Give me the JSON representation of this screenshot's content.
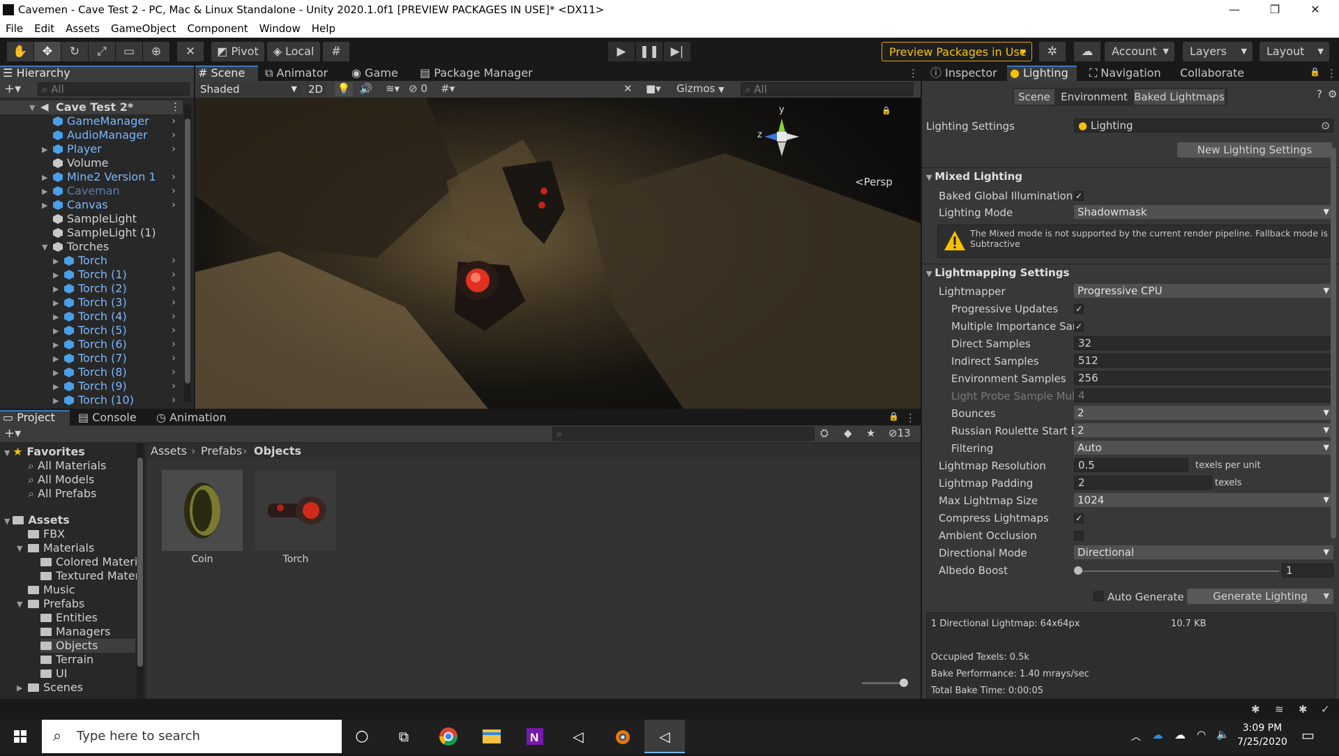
{
  "window": {
    "title": "Cavemen - Cave Test 2 - PC, Mac & Linux Standalone - Unity 2020.1.0f1 [PREVIEW PACKAGES IN USE]* <DX11>",
    "minimize": "—",
    "maximize": "❐",
    "close": "✕"
  },
  "menu": [
    "File",
    "Edit",
    "Assets",
    "GameObject",
    "Component",
    "Window",
    "Help"
  ],
  "toolbar": {
    "pivot": "Pivot",
    "local": "Local",
    "preview_packages": "Preview Packages in Use",
    "account": "Account",
    "layers": "Layers",
    "layout": "Layout"
  },
  "hierarchy": {
    "tab": "Hierarchy",
    "search_placeholder": "All",
    "scene": "Cave Test 2*",
    "items": [
      {
        "label": "GameManager",
        "type": "prefab"
      },
      {
        "label": "AudioManager",
        "type": "prefab"
      },
      {
        "label": "Player",
        "type": "prefab"
      },
      {
        "label": "Volume",
        "type": "object"
      },
      {
        "label": "Mine2 Version 1",
        "type": "prefab"
      },
      {
        "label": "Caveman",
        "type": "prefab-disabled"
      },
      {
        "label": "Canvas",
        "type": "prefab"
      },
      {
        "label": "SampleLight",
        "type": "object"
      },
      {
        "label": "SampleLight (1)",
        "type": "object"
      },
      {
        "label": "Torches",
        "type": "object"
      },
      {
        "label": "Torch",
        "type": "prefab"
      },
      {
        "label": "Torch (1)",
        "type": "prefab"
      },
      {
        "label": "Torch (2)",
        "type": "prefab"
      },
      {
        "label": "Torch (3)",
        "type": "prefab"
      },
      {
        "label": "Torch (4)",
        "type": "prefab"
      },
      {
        "label": "Torch (5)",
        "type": "prefab"
      },
      {
        "label": "Torch (6)",
        "type": "prefab"
      },
      {
        "label": "Torch (7)",
        "type": "prefab"
      },
      {
        "label": "Torch (8)",
        "type": "prefab"
      },
      {
        "label": "Torch (9)",
        "type": "prefab"
      },
      {
        "label": "Torch (10)",
        "type": "prefab"
      }
    ]
  },
  "scene_view": {
    "tabs": [
      "Scene",
      "Animator",
      "Game",
      "Package Manager"
    ],
    "shading": "Shaded",
    "mode_2d": "2D",
    "hidden_count": "0",
    "gizmos": "Gizmos",
    "search_placeholder": "All",
    "persp": "Persp",
    "axis_y": "y",
    "axis_z": "z"
  },
  "project": {
    "tabs": [
      "Project",
      "Console",
      "Animation"
    ],
    "favorites_label": "Favorites",
    "favorites": [
      "All Materials",
      "All Models",
      "All Prefabs"
    ],
    "assets_label": "Assets",
    "tree": [
      {
        "label": "FBX",
        "depth": 1
      },
      {
        "label": "Materials",
        "depth": 1
      },
      {
        "label": "Colored Materia",
        "depth": 2
      },
      {
        "label": "Textured Materi",
        "depth": 2
      },
      {
        "label": "Music",
        "depth": 1
      },
      {
        "label": "Prefabs",
        "depth": 1
      },
      {
        "label": "Entities",
        "depth": 2
      },
      {
        "label": "Managers",
        "depth": 2
      },
      {
        "label": "Objects",
        "depth": 2
      },
      {
        "label": "Terrain",
        "depth": 2
      },
      {
        "label": "UI",
        "depth": 2
      },
      {
        "label": "Scenes",
        "depth": 1
      }
    ],
    "breadcrumb": [
      "Assets",
      "Prefabs",
      "Objects"
    ],
    "assets": [
      "Coin",
      "Torch"
    ],
    "hidden_count": "13"
  },
  "inspector": {
    "tabs": [
      "Inspector",
      "Lighting",
      "Navigation",
      "Collaborate"
    ],
    "subtabs": [
      "Scene",
      "Environment",
      "Baked Lightmaps"
    ],
    "lighting_settings_label": "Lighting Settings",
    "lighting_settings_value": "Lighting",
    "new_settings_btn": "New Lighting Settings",
    "mixed": {
      "title": "Mixed Lighting",
      "baked_gi": "Baked Global Illumination",
      "mode_label": "Lighting Mode",
      "mode_value": "Shadowmask",
      "warning": "The Mixed mode is not supported by the current render pipeline. Fallback mode is Subtractive"
    },
    "lightmapping": {
      "title": "Lightmapping Settings",
      "lightmapper_label": "Lightmapper",
      "lightmapper_value": "Progressive CPU",
      "progressive_updates": "Progressive Updates",
      "multiple_importance": "Multiple Importance San",
      "direct_samples_label": "Direct Samples",
      "direct_samples": "32",
      "indirect_samples_label": "Indirect Samples",
      "indirect_samples": "512",
      "env_samples_label": "Environment Samples",
      "env_samples": "256",
      "probe_mult_label": "Light Probe Sample Mult",
      "probe_mult": "4",
      "bounces_label": "Bounces",
      "bounces": "2",
      "roulette_label": "Russian Roulette Start B",
      "roulette": "2",
      "filtering_label": "Filtering",
      "filtering": "Auto",
      "resolution_label": "Lightmap Resolution",
      "resolution": "0.5",
      "resolution_unit": "texels per unit",
      "padding_label": "Lightmap Padding",
      "padding": "2",
      "padding_unit": "texels",
      "max_size_label": "Max Lightmap Size",
      "max_size": "1024",
      "compress_label": "Compress Lightmaps",
      "ao_label": "Ambient Occlusion",
      "dir_mode_label": "Directional Mode",
      "dir_mode": "Directional",
      "albedo_label": "Albedo Boost",
      "albedo": "1"
    },
    "auto_generate": "Auto Generate",
    "generate_btn": "Generate Lighting",
    "stats": {
      "lightmaps": "1 Directional Lightmap: 64x64px",
      "size": "10.7 KB",
      "texels": "Occupied Texels: 0.5k",
      "perf": "Bake Performance: 1.40 mrays/sec",
      "time": "Total Bake Time: 0:00:05"
    }
  },
  "taskbar": {
    "search_placeholder": "Type here to search",
    "time": "3:09 PM",
    "date": "7/25/2020"
  }
}
